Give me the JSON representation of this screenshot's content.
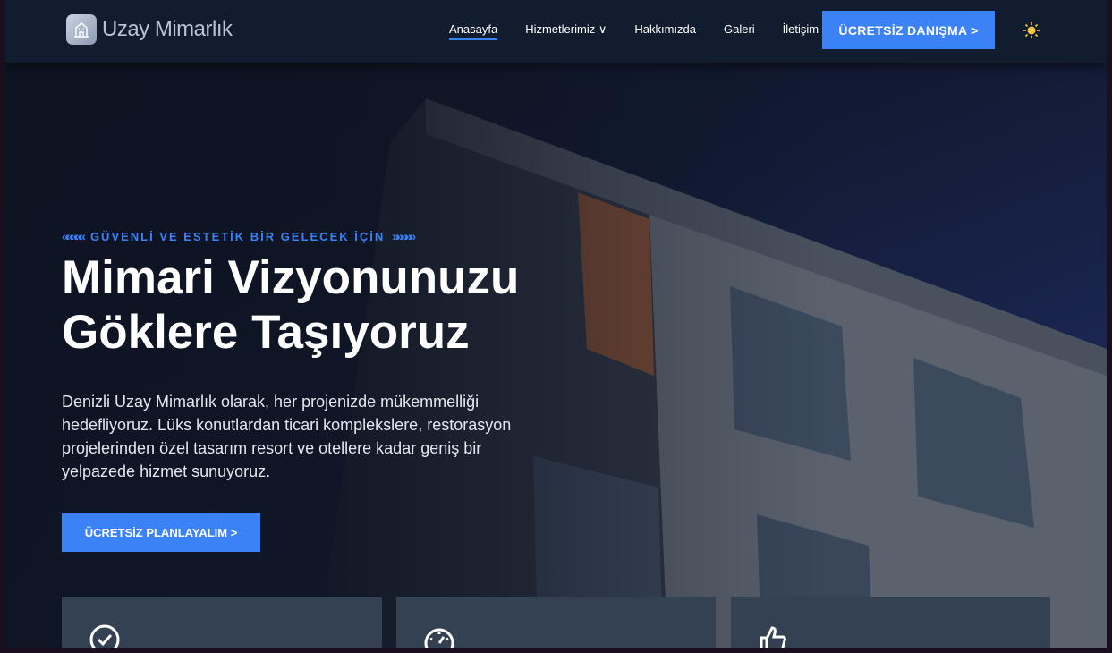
{
  "brand": {
    "name": "Uzay Mimarlık",
    "logo_icon": "building-icon"
  },
  "nav": {
    "items": [
      {
        "label": "Anasayfa",
        "active": true
      },
      {
        "label": "Hizmetlerimiz ∨"
      },
      {
        "label": "Hakkımızda"
      },
      {
        "label": "Galeri"
      },
      {
        "label": "İletişim"
      }
    ],
    "cta": "ÜCRETSİZ DANIŞMA >",
    "theme_icon": "sun-icon"
  },
  "hero": {
    "eyebrow": "GÜVENLİ VE ESTETİK BİR GELECEK İÇİN",
    "eyebrow_left": "«««««",
    "eyebrow_right": "»»»»»",
    "title_line1": "Mimari Vizyonunuzu",
    "title_line2": "Göklere Taşıyoruz",
    "description": "Denizli Uzay Mimarlık olarak, her projenizde mükemmelliği hedefliyoruz. Lüks konutlardan ticari komplekslere, restorasyon projelerinden özel tasarım resort ve otellere kadar geniş bir yelpazede hizmet sunuyoruz.",
    "button": "ÜCRETSİZ PLANLAYALIM >"
  },
  "cards": [
    {
      "icon": "check-circle-icon"
    },
    {
      "icon": "speedometer-icon"
    },
    {
      "icon": "thumbs-up-icon"
    }
  ],
  "colors": {
    "accent": "#3b82f6",
    "nav_bg": "#111c2e",
    "card_bg": "#334152"
  }
}
